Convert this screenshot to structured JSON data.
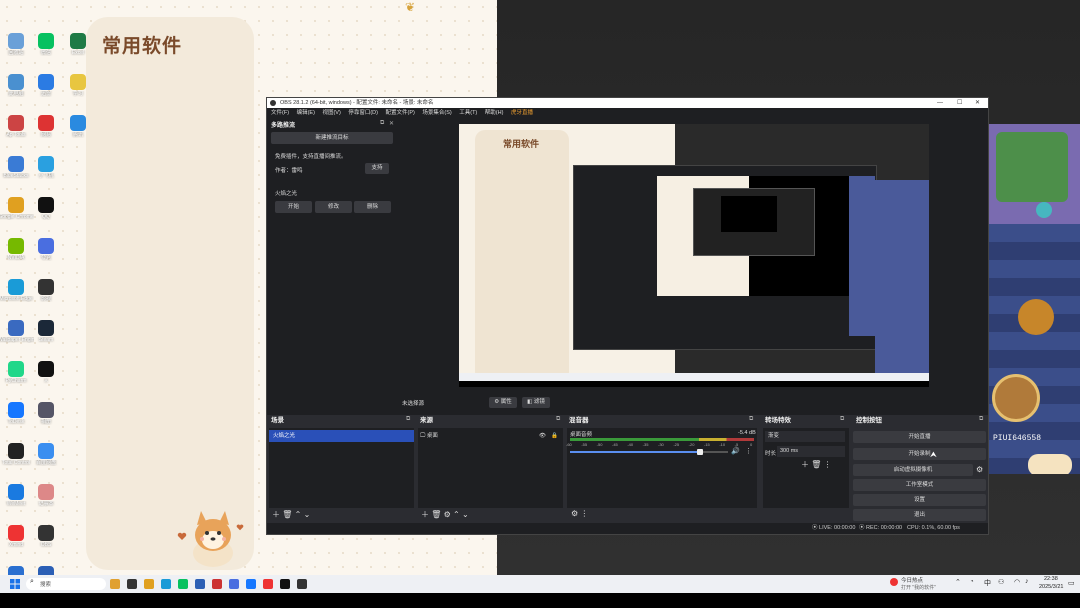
{
  "desktop": {
    "panel_title": "常用软件",
    "icons": [
      {
        "label": "回收站",
        "color": "#6aa0d8"
      },
      {
        "label": "此电脑",
        "color": "#4a90d0"
      },
      {
        "label": "Ap Tools",
        "color": "#c44"
      },
      {
        "label": "BlueStacks",
        "color": "#3a7bd5"
      },
      {
        "label": "Google Chrome",
        "color": "#e0a020"
      },
      {
        "label": "NVIDIA",
        "color": "#76b900"
      },
      {
        "label": "Microsoft Edge",
        "color": "#1a9bd7"
      },
      {
        "label": "Wallpaper Engine",
        "color": "#3a6ac0"
      },
      {
        "label": "PyCharm",
        "color": "#21d789"
      },
      {
        "label": "ToDesk",
        "color": "#1677ff"
      },
      {
        "label": "Total Control",
        "color": "#222"
      },
      {
        "label": "WeMeet",
        "color": "#1a7ae0"
      },
      {
        "label": "Xmind",
        "color": "#e33"
      },
      {
        "label": "Tool",
        "color": "#2a6fd0"
      },
      {
        "label": "微信",
        "color": "#07c160"
      },
      {
        "label": "迅雷",
        "color": "#2b7be3"
      },
      {
        "label": "网易",
        "color": "#d33"
      },
      {
        "label": "小飞机",
        "color": "#2aa0e0"
      },
      {
        "label": "QQ",
        "color": "#111"
      },
      {
        "label": "夸克",
        "color": "#4a6ee0"
      },
      {
        "label": "影视",
        "color": "#333"
      },
      {
        "label": "Steam",
        "color": "#1b2838"
      },
      {
        "label": "X",
        "color": "#111"
      },
      {
        "label": "相册",
        "color": "#556"
      },
      {
        "label": "百度网盘",
        "color": "#3a8ef0"
      },
      {
        "label": "记事本",
        "color": "#d88"
      },
      {
        "label": "OBS",
        "color": "#333"
      },
      {
        "label": "Word",
        "color": "#2b5fb5"
      },
      {
        "label": "Excel",
        "color": "#1f7a45"
      },
      {
        "label": "学习",
        "color": "#e8c640"
      },
      {
        "label": "腾讯",
        "color": "#2a8ae0"
      }
    ]
  },
  "obs": {
    "title": "OBS 28.1.2 (64-bit, windows) - 配置文件: 未命名 - 场景: 未命名",
    "menu": [
      "文件(F)",
      "编辑(E)",
      "视图(V)",
      "停靠窗口(D)",
      "配置文件(P)",
      "场景集合(S)",
      "工具(T)",
      "帮助(H)"
    ],
    "menu_extra": "虎牙直播",
    "multi_dock": {
      "title": "多路推流",
      "create_btn": "新建推流目标",
      "notice": "免费插件，支持直播间推流。",
      "author_label": "作者：雷鸣",
      "support_btn": "支持",
      "target_name": "火焰之光",
      "start_btn": "开始",
      "edit_btn": "修改",
      "delete_btn": "删除"
    },
    "preview_bar": {
      "no_source": "未选择源",
      "properties": "属性",
      "filters": "滤镜"
    },
    "scenes": {
      "title": "场景",
      "items": [
        "火焰之光"
      ]
    },
    "sources": {
      "title": "来源",
      "items": [
        "桌面"
      ]
    },
    "mixer": {
      "title": "混音器",
      "channel": "桌面音频",
      "level": "-5.4 dB",
      "ticks": [
        "-60",
        "-55",
        "-50",
        "-45",
        "-40",
        "-35",
        "-30",
        "-25",
        "-20",
        "-15",
        "-10",
        "-5",
        "0"
      ],
      "volume": 0.82
    },
    "transitions": {
      "title": "转场特效",
      "type": "渐变",
      "duration_label": "时长",
      "duration": "300 ms"
    },
    "controls": {
      "title": "控制按钮",
      "start_stream": "开始直播",
      "start_record": "开始录制",
      "virtual_cam": "启动虚拟摄像机",
      "studio_mode": "工作室模式",
      "settings": "设置",
      "exit": "退出"
    },
    "status": {
      "live": "LIVE: 00:00:00",
      "rec": "REC: 00:00:00",
      "cpu": "CPU: 0.1%, 60.00 fps"
    }
  },
  "game": {
    "id_text": "PIUI646558"
  },
  "taskbar": {
    "search_placeholder": "搜索",
    "weather": "今日热点",
    "weather_sub": "打开 \"我的软件\"",
    "ime": "中",
    "time": "22:38",
    "date": "2025/3/21"
  }
}
